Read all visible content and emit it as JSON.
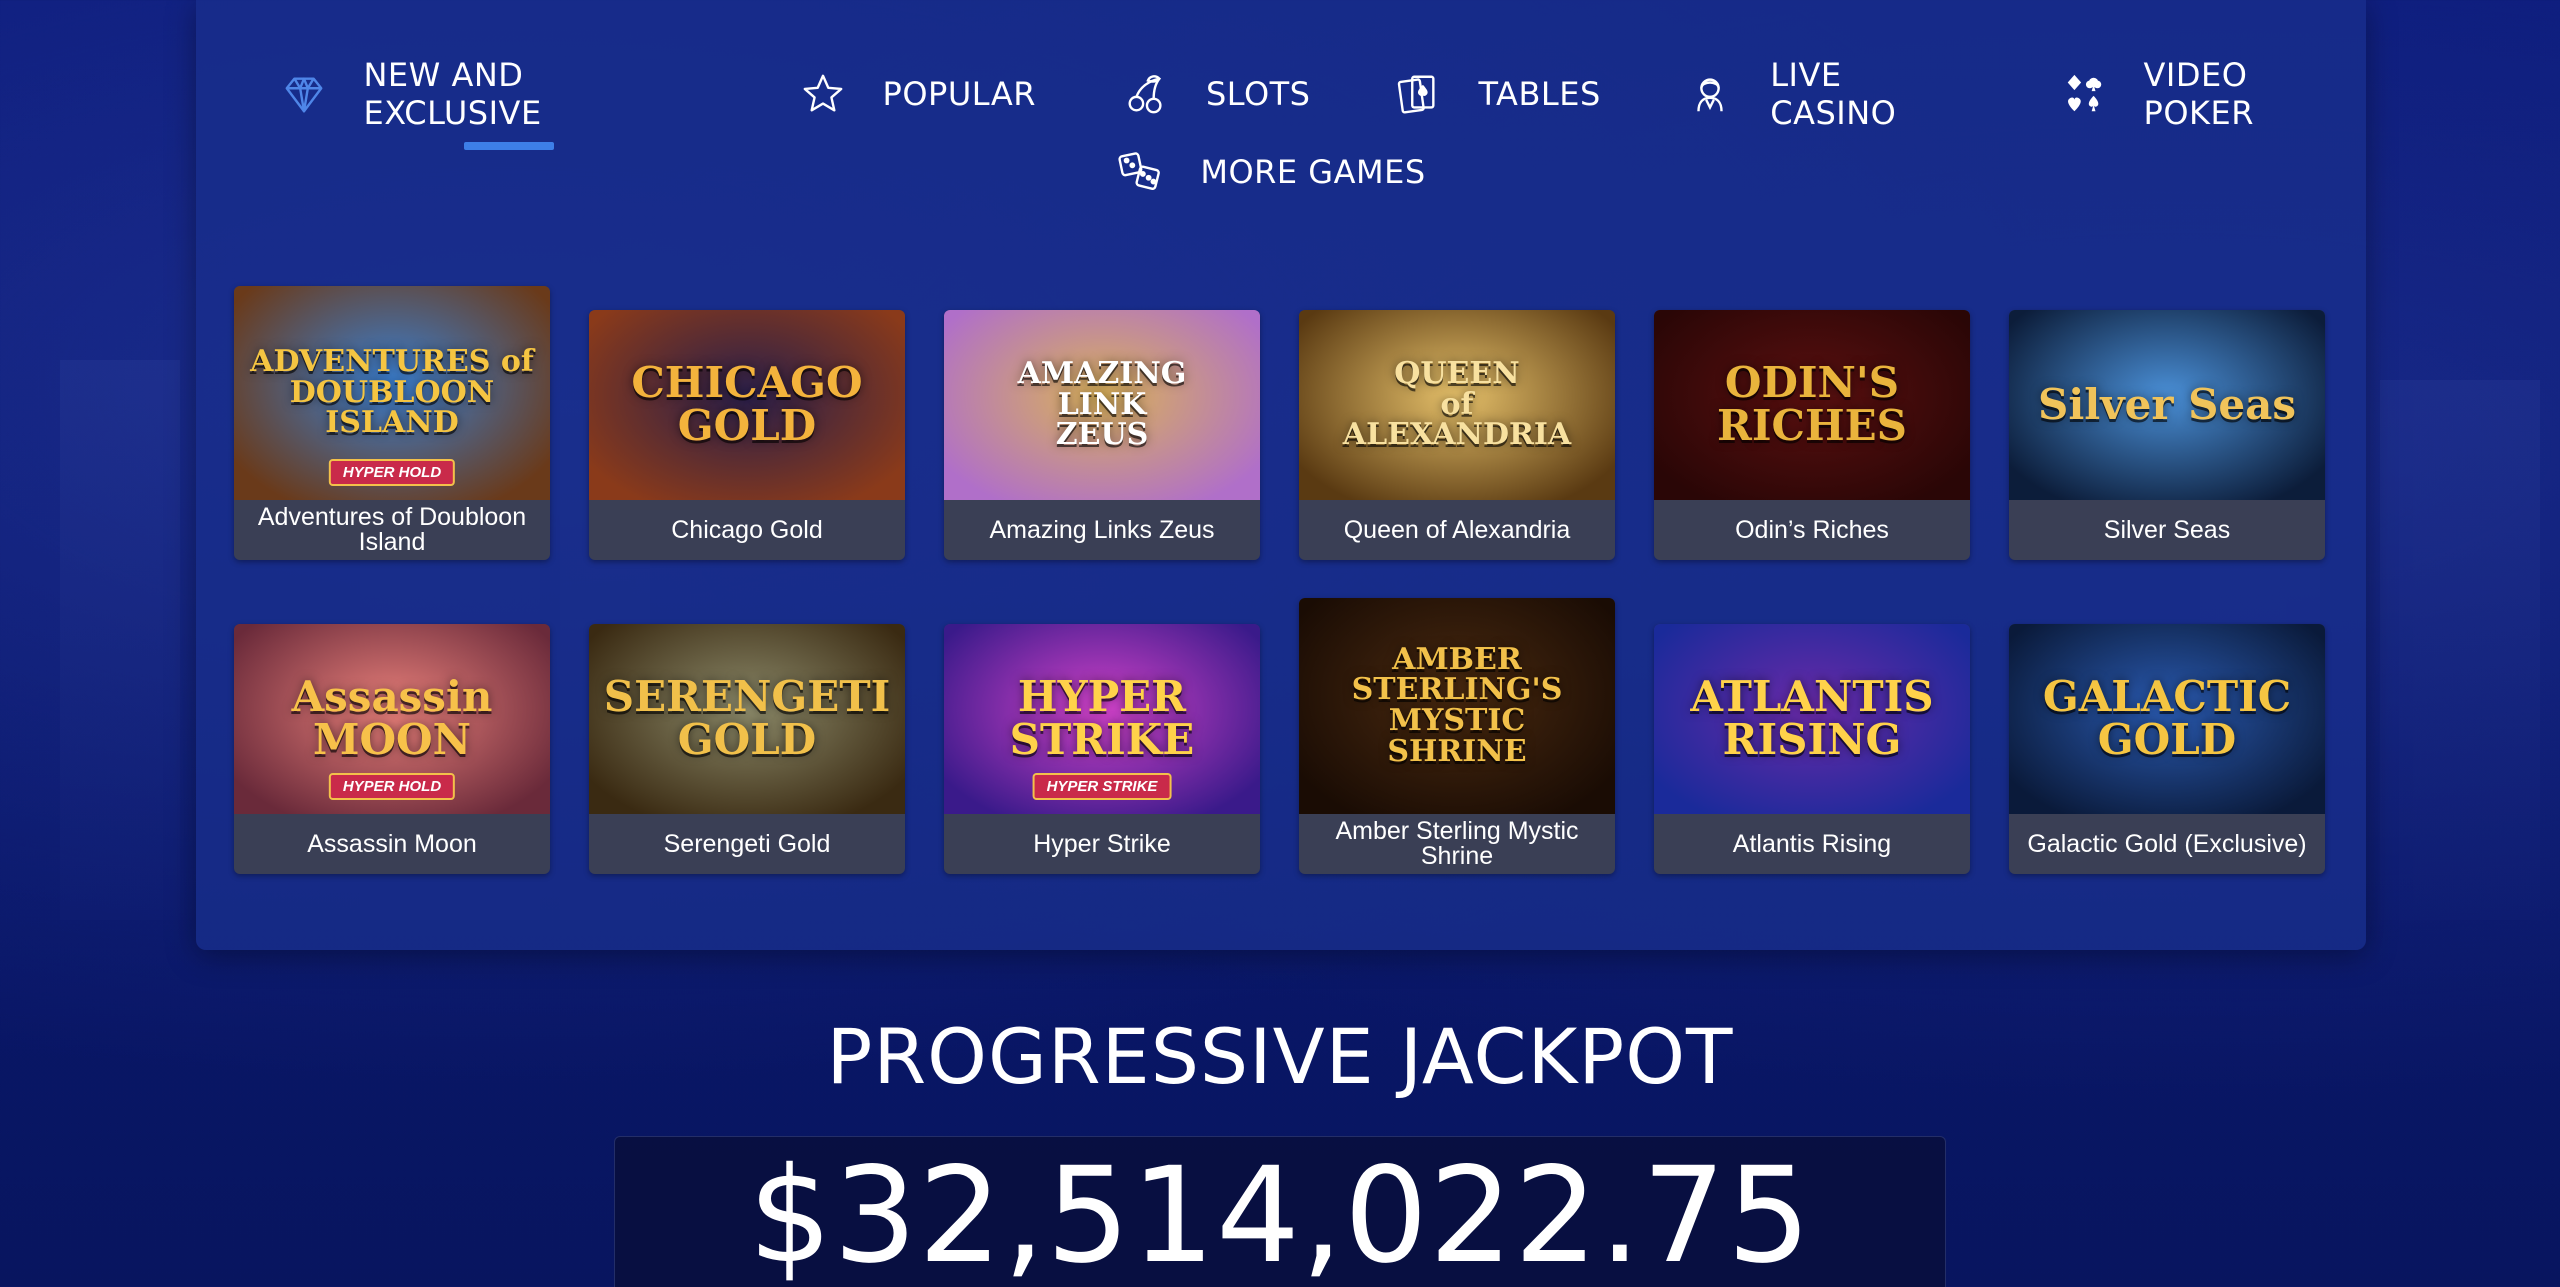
{
  "nav": {
    "items": [
      {
        "id": "new",
        "label": "NEW AND EXCLUSIVE",
        "icon": "diamond-icon",
        "active": true
      },
      {
        "id": "popular",
        "label": "POPULAR",
        "icon": "star-icon",
        "active": false
      },
      {
        "id": "slots",
        "label": "SLOTS",
        "icon": "cherries-icon",
        "active": false
      },
      {
        "id": "tables",
        "label": "TABLES",
        "icon": "playing-cards-icon",
        "active": false
      },
      {
        "id": "live",
        "label": "LIVE CASINO",
        "icon": "dealer-icon",
        "active": false
      },
      {
        "id": "poker",
        "label": "VIDEO POKER",
        "icon": "card-suits-icon",
        "active": false
      },
      {
        "id": "more",
        "label": "MORE GAMES",
        "icon": "dice-icon",
        "active": false
      }
    ],
    "accent_color": "#3d7fe8"
  },
  "games": [
    {
      "name": "Adventures of Doubloon Island",
      "art_text": "ADVENTURES of\nDOUBLOON\nISLAND",
      "badge": "HYPER HOLD",
      "colors": [
        "#3b7fd0",
        "#6a3a1a"
      ],
      "text_color": "#f5c542"
    },
    {
      "name": "Chicago Gold",
      "art_text": "CHICAGO\nGOLD",
      "badge": "",
      "colors": [
        "#2a1f4a",
        "#8a3a1a"
      ],
      "text_color": "#f3b33c"
    },
    {
      "name": "Amazing Links Zeus",
      "art_text": "AMAZING\nLINK\nZEUS",
      "badge": "",
      "colors": [
        "#d9b15a",
        "#b06fc9"
      ],
      "text_color": "#ffffff"
    },
    {
      "name": "Queen of Alexandria",
      "art_text": "QUEEN\nof\nALEXANDRIA",
      "badge": "",
      "colors": [
        "#e5c06a",
        "#5a3a12"
      ],
      "text_color": "#f8e1a0"
    },
    {
      "name": "Odin’s Riches",
      "art_text": "ODIN'S\nRICHES",
      "badge": "",
      "colors": [
        "#5a1010",
        "#2a0606"
      ],
      "text_color": "#e9b43c"
    },
    {
      "name": "Silver Seas",
      "art_text": "Silver Seas",
      "badge": "",
      "colors": [
        "#4a8fd6",
        "#0c1d3a"
      ],
      "text_color": "#f0c35a"
    },
    {
      "name": "Assassin Moon",
      "art_text": "Assassin\nMOON",
      "badge": "HYPER HOLD",
      "colors": [
        "#e8807a",
        "#6a2a3a"
      ],
      "text_color": "#f7c14a"
    },
    {
      "name": "Serengeti Gold",
      "art_text": "SERENGETI\nGOLD",
      "badge": "",
      "colors": [
        "#8c8a6a",
        "#3a2a12"
      ],
      "text_color": "#f1c04a"
    },
    {
      "name": "Hyper Strike",
      "art_text": "HYPER\nSTRIKE",
      "badge": "HYPER STRIKE",
      "colors": [
        "#d042c8",
        "#3a1a8a"
      ],
      "text_color": "#ffd24a"
    },
    {
      "name": "Amber Sterling Mystic Shrine",
      "art_text": "AMBER STERLING'S\nMYSTIC\nSHRINE",
      "badge": "",
      "colors": [
        "#4a2a10",
        "#1a0c04"
      ],
      "text_color": "#f2c14a"
    },
    {
      "name": "Atlantis Rising",
      "art_text": "ATLANTIS\nRISING",
      "badge": "",
      "colors": [
        "#6a2aa8",
        "#1a2a9a"
      ],
      "text_color": "#ffd24a"
    },
    {
      "name": "Galactic Gold (Exclusive)",
      "art_text": "GALACTIC\nGOLD",
      "badge": "",
      "colors": [
        "#2a5ab0",
        "#0a1a3a"
      ],
      "text_color": "#f5c542"
    }
  ],
  "jackpot": {
    "title": "PROGRESSIVE JACKPOT",
    "amount": "$32,514,022.75"
  }
}
